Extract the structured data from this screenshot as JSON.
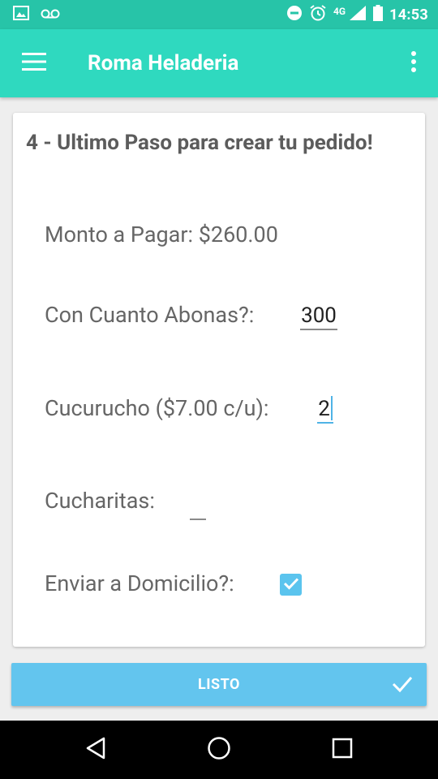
{
  "status_bar": {
    "time": "14:53",
    "network": "4G",
    "icons": [
      "image-icon",
      "voicemail-icon",
      "do-not-disturb-icon",
      "alarm-icon",
      "signal-icon",
      "battery-icon"
    ]
  },
  "app_bar": {
    "title": "Roma Heladeria",
    "menu_icon": "hamburger-menu-icon",
    "overflow_icon": "more-vertical-icon"
  },
  "form": {
    "title": "4 - Ultimo Paso para crear tu pedido!",
    "amount_label": "Monto a Pagar: $260.00",
    "pay_with_label": "Con Cuanto Abonas?:",
    "pay_with_value": "300",
    "cone_label": "Cucurucho ($7.00 c/u):",
    "cone_value": "2",
    "spoons_label": "Cucharitas:",
    "spoons_value": "",
    "delivery_label": "Enviar a Domicilio?:",
    "delivery_checked": true
  },
  "button": {
    "label": "LISTO",
    "icon": "check-icon"
  },
  "nav_bar": {
    "icons": [
      "back-icon",
      "home-icon",
      "recents-icon"
    ]
  },
  "colors": {
    "status_bar": "#27c4a8",
    "app_bar": "#2fd9bf",
    "accent": "#63c5ee",
    "focus": "#4fb3e6"
  }
}
